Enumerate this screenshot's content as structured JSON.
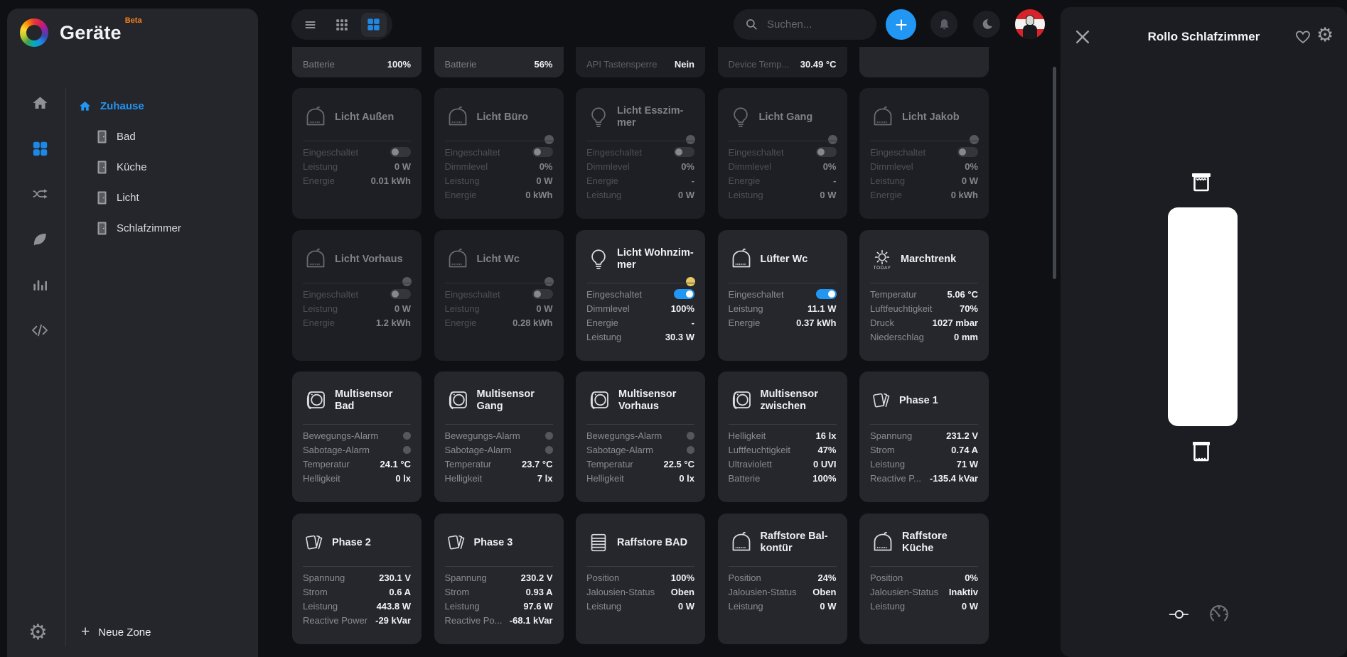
{
  "app": {
    "name": "Geräte",
    "badge": "Beta"
  },
  "colors": {
    "accent_blue": "#2196f3",
    "badge_orange": "#f58220",
    "status_yellow": "#e7c763",
    "status_gray": "#54575c",
    "card_bg": "#26272c",
    "card_bg_dim": "#1e1f24",
    "sidebar_bg": "#25262b",
    "panel_bg": "#1c1d22"
  },
  "sidebar": {
    "nav_icons": [
      "home-icon",
      "dashboard-grid-icon",
      "connections-icon",
      "leaf-icon",
      "statistics-icon",
      "code-icon",
      "settings-gear-icon"
    ],
    "zones": {
      "root": {
        "label": "Zuhause",
        "icon": "home-icon"
      },
      "items": [
        {
          "label": "Bad",
          "icon": "door-icon"
        },
        {
          "label": "Küche",
          "icon": "door-icon"
        },
        {
          "label": "Licht",
          "icon": "door-icon"
        },
        {
          "label": "Schlafzimmer",
          "icon": "door-icon"
        }
      ]
    },
    "new_zone_label": "Neue Zone"
  },
  "topbar": {
    "view_modes": [
      {
        "icon": "list-view-icon",
        "active": false
      },
      {
        "icon": "grid-small-icon",
        "active": false
      },
      {
        "icon": "grid-large-icon",
        "active": true
      }
    ],
    "search": {
      "placeholder": "Suchen...",
      "icon": "search-icon"
    },
    "actions": [
      "add-button",
      "notifications-bell",
      "dark-mode-moon",
      "user-avatar"
    ]
  },
  "grid": {
    "cards": [
      {
        "partial": true,
        "dim": false,
        "rows": [
          {
            "label": "Batterie",
            "value": "100%"
          }
        ]
      },
      {
        "partial": true,
        "dim": false,
        "rows": [
          {
            "label": "Batterie",
            "value": "56%"
          }
        ]
      },
      {
        "partial": true,
        "dim": true,
        "rows": [
          {
            "label": "API Tastensperre",
            "value": "Nein"
          }
        ]
      },
      {
        "partial": true,
        "dim": true,
        "rows": [
          {
            "label": "Device Temp...",
            "value": "30.49 °C"
          }
        ]
      },
      {
        "partial": true,
        "dim": false,
        "rows": []
      },
      {
        "title": "Licht Außen",
        "icon": "shelly-relay-icon",
        "dim": true,
        "dot": null,
        "rows": [
          {
            "label": "Eingeschaltet",
            "type": "toggle",
            "on": false
          },
          {
            "label": "Leistung",
            "value": "0 W"
          },
          {
            "label": "Energie",
            "value": "0.01 kWh"
          }
        ]
      },
      {
        "title": "Licht Büro",
        "icon": "shelly-relay-icon",
        "dim": true,
        "dot": "gray",
        "rows": [
          {
            "label": "Eingeschaltet",
            "type": "toggle",
            "on": false
          },
          {
            "label": "Dimmlevel",
            "value": "0%"
          },
          {
            "label": "Leistung",
            "value": "0 W"
          },
          {
            "label": "Energie",
            "value": "0 kWh"
          }
        ]
      },
      {
        "title": "Licht Esszim-\nmer",
        "icon": "bulb-icon",
        "dim": true,
        "dot": "gray",
        "rows": [
          {
            "label": "Eingeschaltet",
            "type": "toggle",
            "on": false
          },
          {
            "label": "Dimmlevel",
            "value": "0%"
          },
          {
            "label": "Energie",
            "value": "-"
          },
          {
            "label": "Leistung",
            "value": "0 W"
          }
        ]
      },
      {
        "title": "Licht Gang",
        "icon": "bulb-icon",
        "dim": true,
        "dot": "gray",
        "rows": [
          {
            "label": "Eingeschaltet",
            "type": "toggle",
            "on": false
          },
          {
            "label": "Dimmlevel",
            "value": "0%"
          },
          {
            "label": "Energie",
            "value": "-"
          },
          {
            "label": "Leistung",
            "value": "0 W"
          }
        ]
      },
      {
        "title": "Licht Jakob",
        "icon": "shelly-relay-icon",
        "dim": true,
        "dot": "gray",
        "rows": [
          {
            "label": "Eingeschaltet",
            "type": "toggle",
            "on": false
          },
          {
            "label": "Dimmlevel",
            "value": "0%"
          },
          {
            "label": "Leistung",
            "value": "0 W"
          },
          {
            "label": "Energie",
            "value": "0 kWh"
          }
        ]
      },
      {
        "title": "Licht Vorhaus",
        "icon": "shelly-relay-icon",
        "dim": true,
        "dot": "gray",
        "rows": [
          {
            "label": "Eingeschaltet",
            "type": "toggle",
            "on": false
          },
          {
            "label": "Leistung",
            "value": "0 W"
          },
          {
            "label": "Energie",
            "value": "1.2 kWh"
          }
        ]
      },
      {
        "title": "Licht Wc",
        "icon": "shelly-relay-icon",
        "dim": true,
        "dot": "gray",
        "rows": [
          {
            "label": "Eingeschaltet",
            "type": "toggle",
            "on": false
          },
          {
            "label": "Leistung",
            "value": "0 W"
          },
          {
            "label": "Energie",
            "value": "0.28 kWh"
          }
        ]
      },
      {
        "title": "Licht Wohnzim-\nmer",
        "icon": "bulb-icon",
        "dim": false,
        "dot": "yellow",
        "rows": [
          {
            "label": "Eingeschaltet",
            "type": "toggle",
            "on": true
          },
          {
            "label": "Dimmlevel",
            "value": "100%"
          },
          {
            "label": "Energie",
            "value": "-"
          },
          {
            "label": "Leistung",
            "value": "30.3 W"
          }
        ]
      },
      {
        "title": "Lüfter Wc",
        "icon": "shelly-relay-icon",
        "dim": false,
        "dot": null,
        "rows": [
          {
            "label": "Eingeschaltet",
            "type": "toggle",
            "on": true
          },
          {
            "label": "Leistung",
            "value": "11.1 W"
          },
          {
            "label": "Energie",
            "value": "0.37 kWh"
          }
        ]
      },
      {
        "title": "Marchtrenk",
        "icon": "weather-today-icon",
        "caption": "TODAY",
        "dim": false,
        "dot": null,
        "rows": [
          {
            "label": "Temperatur",
            "value": "5.06 °C"
          },
          {
            "label": "Luftfeuchtigkeit",
            "value": "70%"
          },
          {
            "label": "Druck",
            "value": "1027 mbar"
          },
          {
            "label": "Niederschlag",
            "value": "0 mm"
          }
        ]
      },
      {
        "title": "Multisensor Bad",
        "icon": "multisensor-icon",
        "dim": false,
        "dot": null,
        "rows": [
          {
            "label": "Bewegungs-Alarm",
            "type": "dot"
          },
          {
            "label": "Sabotage-Alarm",
            "type": "dot"
          },
          {
            "label": "Temperatur",
            "value": "24.1 °C"
          },
          {
            "label": "Helligkeit",
            "value": "0 lx"
          }
        ]
      },
      {
        "title": "Multisensor\nGang",
        "icon": "multisensor-icon",
        "dim": false,
        "dot": null,
        "rows": [
          {
            "label": "Bewegungs-Alarm",
            "type": "dot"
          },
          {
            "label": "Sabotage-Alarm",
            "type": "dot"
          },
          {
            "label": "Temperatur",
            "value": "23.7 °C"
          },
          {
            "label": "Helligkeit",
            "value": "7 lx"
          }
        ]
      },
      {
        "title": "Multisensor\nVorhaus",
        "icon": "multisensor-icon",
        "dim": false,
        "dot": null,
        "rows": [
          {
            "label": "Bewegungs-Alarm",
            "type": "dot"
          },
          {
            "label": "Sabotage-Alarm",
            "type": "dot"
          },
          {
            "label": "Temperatur",
            "value": "22.5 °C"
          },
          {
            "label": "Helligkeit",
            "value": "0 lx"
          }
        ]
      },
      {
        "title": "Multisensor\nzwischen",
        "icon": "multisensor-icon",
        "dim": false,
        "dot": null,
        "rows": [
          {
            "label": "Helligkeit",
            "value": "16 lx"
          },
          {
            "label": "Luftfeuchtigkeit",
            "value": "47%"
          },
          {
            "label": "Ultraviolett",
            "value": "0 UVI"
          },
          {
            "label": "Batterie",
            "value": "100%"
          }
        ]
      },
      {
        "title": "Phase 1",
        "icon": "phase-icon",
        "dim": false,
        "dot": null,
        "rows": [
          {
            "label": "Spannung",
            "value": "231.2 V"
          },
          {
            "label": "Strom",
            "value": "0.74 A"
          },
          {
            "label": "Leistung",
            "value": "71 W"
          },
          {
            "label": "Reactive P...",
            "value": "-135.4 kVar"
          }
        ]
      },
      {
        "title": "Phase 2",
        "icon": "phase-icon",
        "dim": false,
        "dot": null,
        "rows": [
          {
            "label": "Spannung",
            "value": "230.1 V"
          },
          {
            "label": "Strom",
            "value": "0.6 A"
          },
          {
            "label": "Leistung",
            "value": "443.8 W"
          },
          {
            "label": "Reactive Power",
            "value": "-29 kVar"
          }
        ]
      },
      {
        "title": "Phase 3",
        "icon": "phase-icon",
        "dim": false,
        "dot": null,
        "rows": [
          {
            "label": "Spannung",
            "value": "230.2 V"
          },
          {
            "label": "Strom",
            "value": "0.93 A"
          },
          {
            "label": "Leistung",
            "value": "97.6 W"
          },
          {
            "label": "Reactive Po...",
            "value": "-68.1 kVar"
          }
        ]
      },
      {
        "title": "Raffstore BAD",
        "icon": "blinds-icon",
        "dim": false,
        "dot": null,
        "rows": [
          {
            "label": "Position",
            "value": "100%"
          },
          {
            "label": "Jalousien-Status",
            "value": "Oben"
          },
          {
            "label": "Leistung",
            "value": "0 W"
          }
        ]
      },
      {
        "title": "Raffstore Bal-\nkontür",
        "icon": "shelly-relay-icon",
        "dim": false,
        "dot": null,
        "rows": [
          {
            "label": "Position",
            "value": "24%"
          },
          {
            "label": "Jalousien-Status",
            "value": "Oben"
          },
          {
            "label": "Leistung",
            "value": "0 W"
          }
        ]
      },
      {
        "title": "Raffstore Küche",
        "icon": "shelly-relay-icon",
        "dim": false,
        "dot": null,
        "rows": [
          {
            "label": "Position",
            "value": "0%"
          },
          {
            "label": "Jalousien-Status",
            "value": "Inaktiv"
          },
          {
            "label": "Leistung",
            "value": "0 W"
          }
        ]
      }
    ]
  },
  "detail_panel": {
    "title": "Rollo Schlafzimmer",
    "header_icons": [
      "close-icon",
      "favorite-heart-icon",
      "settings-gear-icon"
    ],
    "shutter": {
      "up_icon": "blind-open-icon",
      "down_icon": "blind-closed-icon",
      "slider_color": "#ffffff"
    },
    "footer_icons": [
      "slider-control-icon",
      "gauge-icon"
    ]
  }
}
